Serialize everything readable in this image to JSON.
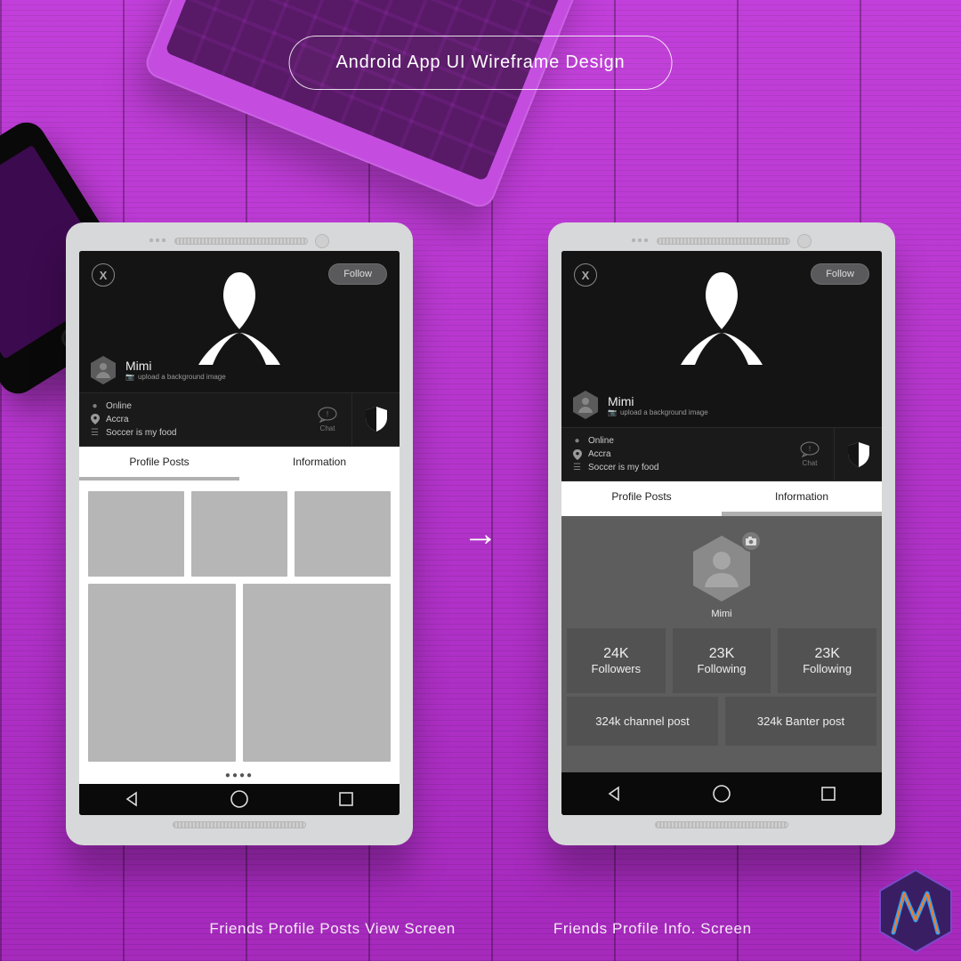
{
  "page_title": "Android App UI Wireframe Design",
  "captions": {
    "left": "Friends Profile Posts View Screen",
    "right": "Friends Profile Info. Screen"
  },
  "profile": {
    "close": "X",
    "follow": "Follow",
    "name": "Mimi",
    "upload_hint": "upload a background image",
    "status_online": "Online",
    "location": "Accra",
    "bio": "Soccer is my food",
    "chat_label": "Chat"
  },
  "tabs": {
    "posts": "Profile Posts",
    "info": "Information"
  },
  "pager": "●●●●",
  "info": {
    "name": "Mimi",
    "stats": [
      {
        "value": "24K",
        "label": "Followers"
      },
      {
        "value": "23K",
        "label": "Following"
      },
      {
        "value": "23K",
        "label": "Following"
      }
    ],
    "counters": [
      "324k channel post",
      "324k Banter post"
    ]
  }
}
